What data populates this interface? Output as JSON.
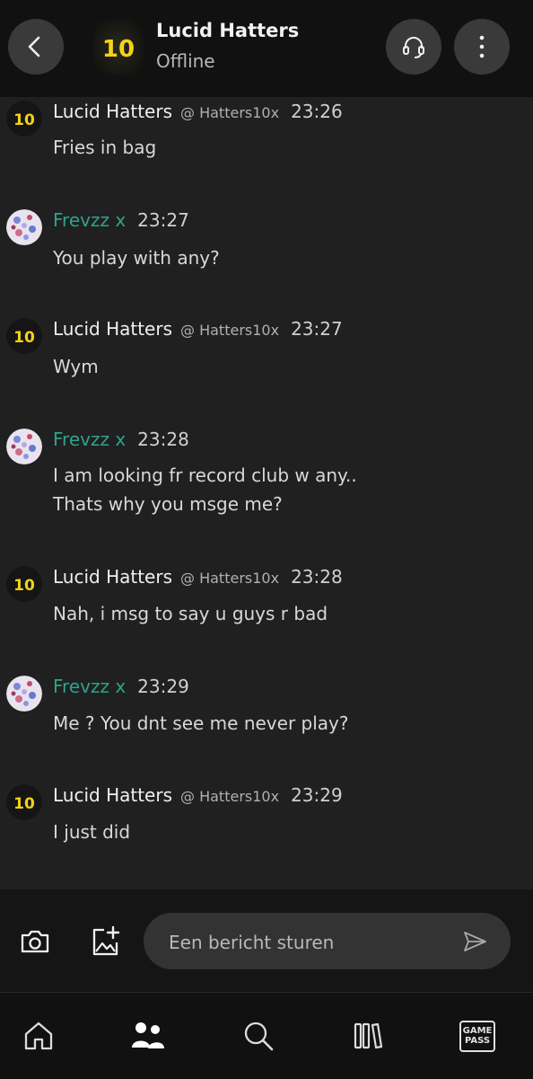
{
  "header": {
    "title": "Lucid Hatters",
    "status": "Offline",
    "avatar_text": "10"
  },
  "messages": [
    {
      "sender": "Lucid Hatters",
      "handle": "@ Hatters10x",
      "time": "23:26",
      "lines": [
        "Fries in bag"
      ],
      "avatar": "lucid"
    },
    {
      "sender": "Frevzz x",
      "handle": "",
      "time": "23:27",
      "lines": [
        "You play with any?"
      ],
      "avatar": "frev"
    },
    {
      "sender": "Lucid Hatters",
      "handle": "@ Hatters10x",
      "time": "23:27",
      "lines": [
        "Wym"
      ],
      "avatar": "lucid"
    },
    {
      "sender": "Frevzz x",
      "handle": "",
      "time": "23:28",
      "lines": [
        "I am looking fr record club w any..",
        "Thats why you msge me?"
      ],
      "avatar": "frev"
    },
    {
      "sender": "Lucid Hatters",
      "handle": "@ Hatters10x",
      "time": "23:28",
      "lines": [
        "Nah, i msg to say u guys r bad"
      ],
      "avatar": "lucid"
    },
    {
      "sender": "Frevzz x",
      "handle": "",
      "time": "23:29",
      "lines": [
        "Me ? You dnt see me never play?"
      ],
      "avatar": "frev"
    },
    {
      "sender": "Lucid Hatters",
      "handle": "@ Hatters10x",
      "time": "23:29",
      "lines": [
        "I just did"
      ],
      "avatar": "lucid"
    }
  ],
  "composer": {
    "placeholder": "Een bericht sturen"
  },
  "nav": {
    "game_pass_line1": "GAME",
    "game_pass_line2": "PASS"
  },
  "colors": {
    "accent": "#2ea38a",
    "background": "#202020",
    "header": "#111111"
  },
  "icons": [
    "back-icon",
    "headset-icon",
    "more-icon",
    "camera-icon",
    "add-image-icon",
    "send-icon",
    "home-icon",
    "people-icon",
    "search-icon",
    "library-icon"
  ]
}
